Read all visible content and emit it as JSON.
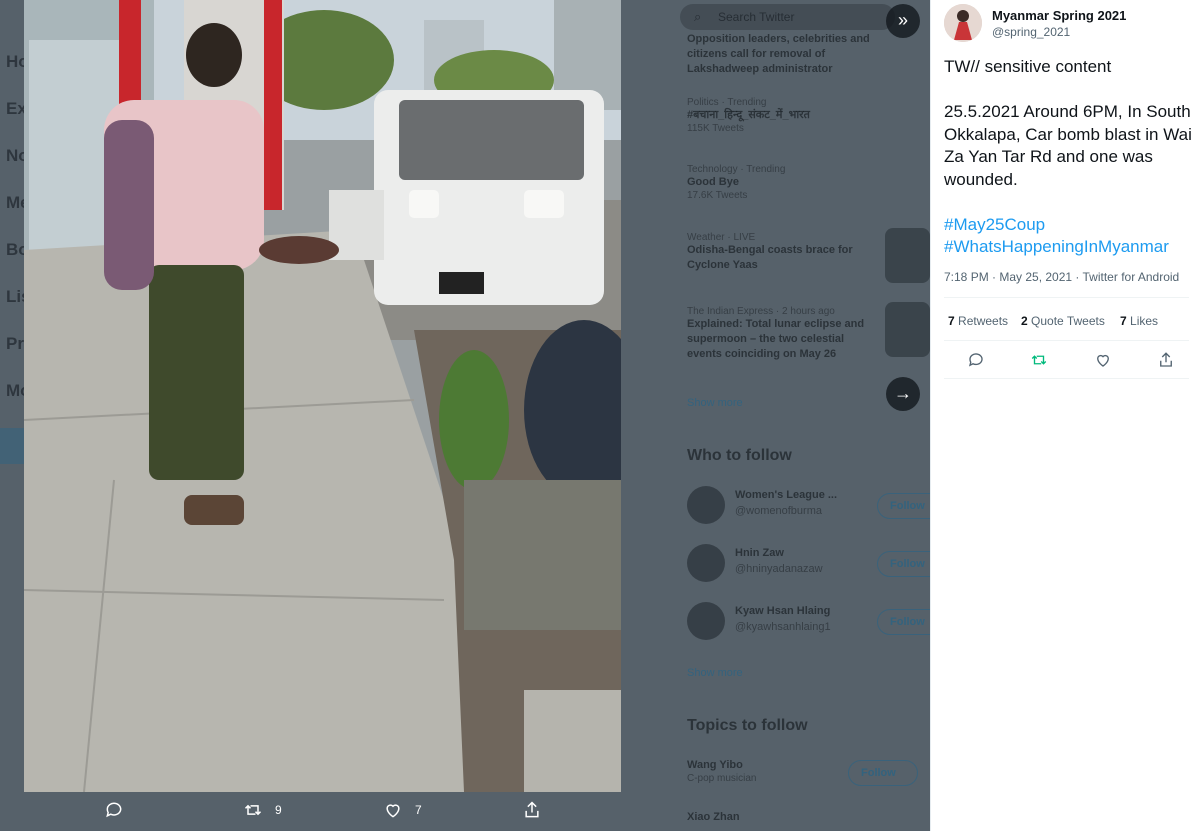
{
  "backdrop": {
    "nav_items": [
      "Ho",
      "Ex",
      "No",
      "Me",
      "Bo",
      "Lis",
      "Pr",
      "Mo"
    ],
    "search_placeholder": "Search Twitter",
    "trends": [
      {
        "meta": "",
        "title": "Opposition leaders, celebrities and citizens call for removal of Lakshadweep administrator",
        "sub": ""
      },
      {
        "meta": "Politics · Trending",
        "title": "#बचाना_हिन्दू_संकट_में_भारत",
        "sub": "115K Tweets"
      },
      {
        "meta": "Technology · Trending",
        "title": "Good Bye",
        "sub": "17.6K Tweets"
      },
      {
        "meta": "Weather · LIVE",
        "title": "Odisha-Bengal coasts brace for Cyclone Yaas",
        "sub": ""
      },
      {
        "meta": "The Indian Express · 2 hours ago",
        "title": "Explained: Total lunar eclipse and supermoon – the two celestial events coinciding on May 26",
        "sub": ""
      }
    ],
    "show_more": "Show more",
    "who_to_follow_title": "Who to follow",
    "who_to_follow": [
      {
        "name": "Women's League ...",
        "handle": "@womenofburma"
      },
      {
        "name": "Hnin Zaw",
        "handle": "@hninyadanazaw"
      },
      {
        "name": "Kyaw Hsan Hlaing",
        "handle": "@kyawhsanhlaing1"
      }
    ],
    "follow_label": "Follow",
    "topics_title": "Topics to follow",
    "topics": [
      {
        "name": "Wang Yibo",
        "category": "C-pop musician"
      },
      {
        "name": "Xiao Zhan",
        "category": ""
      }
    ]
  },
  "media_actions": {
    "retweets": "9",
    "likes": "7"
  },
  "tweet": {
    "author_name": "Myanmar Spring 2021",
    "author_handle": "@spring_2021",
    "line1": "TW// sensitive content",
    "line2": "25.5.2021 Around 6PM, In South Okkalapa, Car bomb blast in Wai Za Yan Tar Rd and one was wounded.",
    "hashtags": [
      "#May25Coup",
      "#WhatsHappeningInMyanmar"
    ],
    "meta": "7:18 PM · May 25, 2021 · Twitter for Android",
    "retweets_count": "7",
    "retweets_label": "Retweets",
    "quotes_count": "2",
    "quotes_label": "Quote Tweets",
    "likes_count": "7",
    "likes_label": "Likes"
  },
  "colors": {
    "accent": "#1d9bf0",
    "retweet_green": "#00ba7c",
    "backdrop": "#56616a"
  },
  "icons": [
    "expand-icon",
    "arrow-right-icon",
    "reply-icon",
    "retweet-icon",
    "like-icon",
    "share-icon",
    "search-icon"
  ]
}
